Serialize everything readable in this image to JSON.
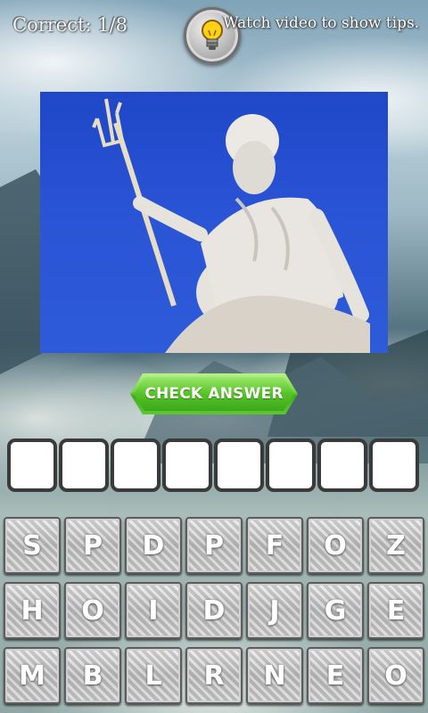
{
  "header": {
    "score_text": "Correct: 1/8",
    "hint_icon": "lightbulb-icon",
    "tips_text": "Watch video to show tips."
  },
  "puzzle": {
    "image_icon": "poseidon-statue-image"
  },
  "actions": {
    "check_label": "CHECK ANSWER"
  },
  "answer": {
    "slots": [
      "",
      "",
      "",
      "",
      "",
      "",
      "",
      ""
    ]
  },
  "keyboard": {
    "rows": [
      [
        "S",
        "P",
        "D",
        "P",
        "F",
        "O",
        "Z"
      ],
      [
        "H",
        "O",
        "I",
        "D",
        "J",
        "G",
        "E"
      ],
      [
        "M",
        "B",
        "L",
        "R",
        "N",
        "E",
        "O"
      ]
    ]
  },
  "colors": {
    "check_button": "#56c227",
    "picture_sky": "#2a55d6",
    "slot_border": "#3a3a3a"
  }
}
